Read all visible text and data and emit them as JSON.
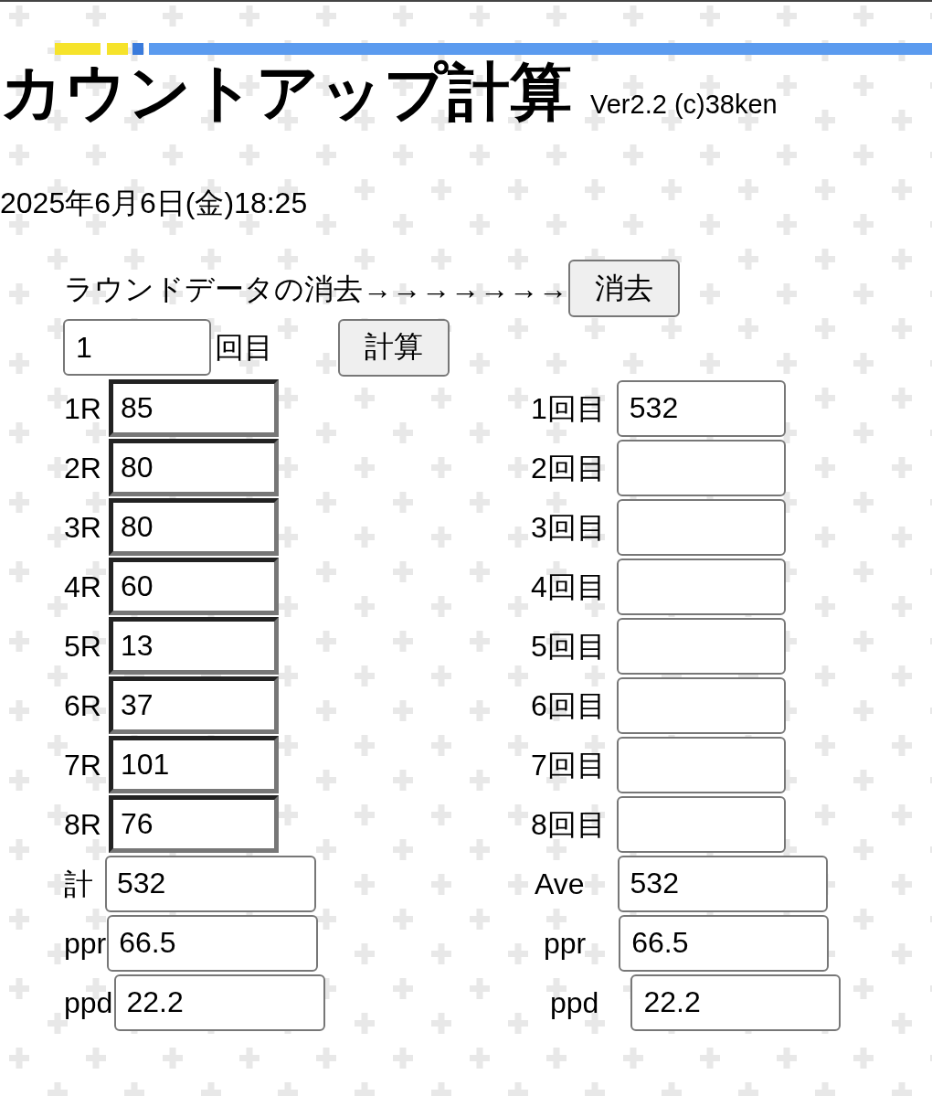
{
  "header": {
    "title": "カウントアップ計算",
    "version": "Ver2.2 (c)38ken"
  },
  "datetime": "2025年6月6日(金)18:25",
  "clear": {
    "label": "ラウンドデータの消去→→→→→→→",
    "button": "消去"
  },
  "game": {
    "value": "1",
    "suffix": "回目",
    "button": "計算"
  },
  "rounds": [
    {
      "label": "1R",
      "value": "85"
    },
    {
      "label": "2R",
      "value": "80"
    },
    {
      "label": "3R",
      "value": "80"
    },
    {
      "label": "4R",
      "value": "60"
    },
    {
      "label": "5R",
      "value": "13"
    },
    {
      "label": "6R",
      "value": "37"
    },
    {
      "label": "7R",
      "value": "101"
    },
    {
      "label": "8R",
      "value": "76"
    }
  ],
  "games": [
    {
      "label": "1回目",
      "value": "532"
    },
    {
      "label": "2回目"
    },
    {
      "label": "3回目"
    },
    {
      "label": "4回目"
    },
    {
      "label": "5回目"
    },
    {
      "label": "6回目"
    },
    {
      "label": "7回目"
    },
    {
      "label": "8回目"
    }
  ],
  "totals": [
    {
      "label": "計",
      "value": "532"
    },
    {
      "label": "ppr",
      "value": "66.5"
    },
    {
      "label": "ppd",
      "value": "22.2"
    }
  ],
  "averages": [
    {
      "label": "Ave",
      "value": "532"
    },
    {
      "label": "ppr",
      "value": "66.5"
    },
    {
      "label": "ppd",
      "value": "22.2"
    }
  ]
}
